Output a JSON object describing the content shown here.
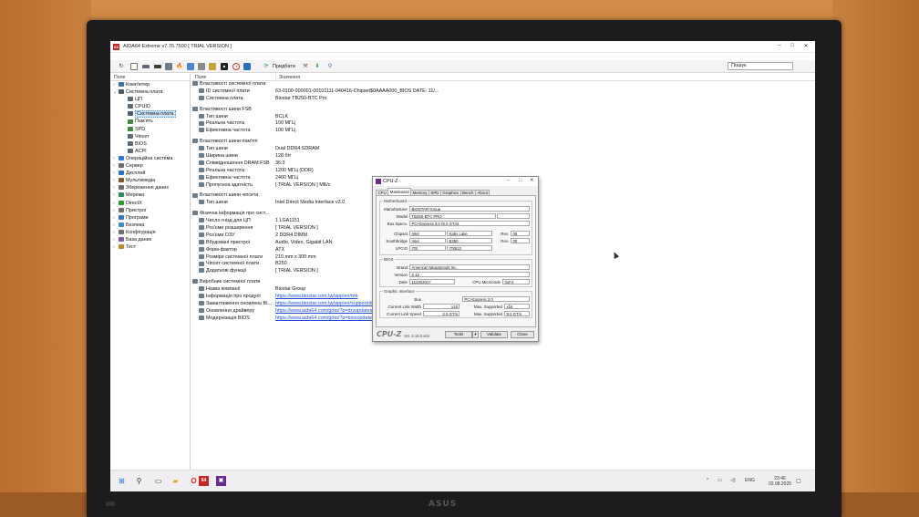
{
  "window": {
    "title": "AIDA64 Extreme v7.70.7500  [ TRIAL VERSION ]",
    "app_icon_text": "64"
  },
  "toolbar": {
    "report_label": "Придбати",
    "search_placeholder": "Пошук"
  },
  "tree": {
    "header": "Поле",
    "items": [
      {
        "label": "Комп'ютер",
        "level": 0,
        "expander": "›",
        "color": "#3b6fb6"
      },
      {
        "label": "Системна плата",
        "level": 0,
        "expander": "⌄",
        "color": "#4a5d70"
      },
      {
        "label": "ЦП",
        "level": 1,
        "expander": "",
        "color": "#5b6b7a"
      },
      {
        "label": "CPUID",
        "level": 1,
        "expander": "",
        "color": "#5b6b7a"
      },
      {
        "label": "Системна плата",
        "level": 1,
        "expander": "",
        "color": "#4a5d70",
        "selected": true
      },
      {
        "label": "Пам'ять",
        "level": 1,
        "expander": "",
        "color": "#3f8a3f"
      },
      {
        "label": "SPD",
        "level": 1,
        "expander": "",
        "color": "#3f8a3f"
      },
      {
        "label": "Чіпсет",
        "level": 1,
        "expander": "",
        "color": "#5b6b7a"
      },
      {
        "label": "BIOS",
        "level": 1,
        "expander": "",
        "color": "#5b6b7a"
      },
      {
        "label": "ACPI",
        "level": 1,
        "expander": "",
        "color": "#5b6b7a"
      },
      {
        "label": "Операційна система",
        "level": 0,
        "expander": "›",
        "color": "#2f7ad0"
      },
      {
        "label": "Сервер",
        "level": 0,
        "expander": "›",
        "color": "#6d6d6d"
      },
      {
        "label": "Дисплей",
        "level": 0,
        "expander": "›",
        "color": "#2f6fc0"
      },
      {
        "label": "Мультимедіа",
        "level": 0,
        "expander": "›",
        "color": "#7d5a2e"
      },
      {
        "label": "Збереження даних",
        "level": 0,
        "expander": "›",
        "color": "#6d6d6d"
      },
      {
        "label": "Мережа",
        "level": 0,
        "expander": "›",
        "color": "#2e8a5a"
      },
      {
        "label": "DirectX",
        "level": 0,
        "expander": "›",
        "color": "#2f9a2f"
      },
      {
        "label": "Пристрої",
        "level": 0,
        "expander": "›",
        "color": "#6d6d6d"
      },
      {
        "label": "Програми",
        "level": 0,
        "expander": "›",
        "color": "#3a6fc0"
      },
      {
        "label": "Безпека",
        "level": 0,
        "expander": "›",
        "color": "#3a8ad0"
      },
      {
        "label": "Конфігурація",
        "level": 0,
        "expander": "›",
        "color": "#6d6d6d"
      },
      {
        "label": "База даних",
        "level": 0,
        "expander": "›",
        "color": "#7a5a9a"
      },
      {
        "label": "Тест",
        "level": 0,
        "expander": "›",
        "color": "#c0882e"
      }
    ]
  },
  "list": {
    "col_field": "Поле",
    "col_value": "Значення",
    "rows": [
      {
        "type": "sec",
        "field": "Властивості системної плати",
        "value": ""
      },
      {
        "type": "sub",
        "field": "ID системної плати",
        "value": "63-0100-000001-00101111-040416-Chipset$0AAAA000_BIOS DATE: 11/..."
      },
      {
        "type": "sub",
        "field": "Системна плата",
        "value": "Biostar TB250-BTC Pro"
      },
      {
        "type": "gap"
      },
      {
        "type": "sec",
        "field": "Властивості шини FSB",
        "value": ""
      },
      {
        "type": "sub",
        "field": "Тип шини",
        "value": "BCLK"
      },
      {
        "type": "sub",
        "field": "Реальна частота",
        "value": "100 МГЦ"
      },
      {
        "type": "sub",
        "field": "Ефективна частота",
        "value": "100 МГЦ"
      },
      {
        "type": "gap"
      },
      {
        "type": "sec",
        "field": "Властивості шини пам'яті",
        "value": ""
      },
      {
        "type": "sub",
        "field": "Тип шини",
        "value": "Dual DDR4 SDRAM"
      },
      {
        "type": "sub",
        "field": "Ширина шини",
        "value": "128 біт"
      },
      {
        "type": "sub",
        "field": "Співвідношення DRAM:FSB",
        "value": "36:3"
      },
      {
        "type": "sub",
        "field": "Реальна частота",
        "value": "1200 МГЦ (DDR)"
      },
      {
        "type": "sub",
        "field": "Ефективна частота",
        "value": "2400 МГЦ"
      },
      {
        "type": "sub",
        "field": "Пропускна здатність",
        "value": "[ TRIAL VERSION ] МБ/с"
      },
      {
        "type": "gap"
      },
      {
        "type": "sec",
        "field": "Властивості шини чіпсета",
        "value": ""
      },
      {
        "type": "sub",
        "field": "Тип шини",
        "value": "Intel Direct Media Interface v3.0"
      },
      {
        "type": "gap"
      },
      {
        "type": "sec",
        "field": "Фізична інформація про сист...",
        "value": ""
      },
      {
        "type": "sub",
        "field": "Число гнізд для ЦП",
        "value": "1 LGA1151"
      },
      {
        "type": "sub",
        "field": "Роз'єми розширення",
        "value": "[ TRIAL VERSION ]"
      },
      {
        "type": "sub",
        "field": "Роз'єми ОЗУ",
        "value": "2 DDR4 DIMM"
      },
      {
        "type": "sub",
        "field": "Вбудовані пристрої",
        "value": "Audio, Video, Gigabit LAN"
      },
      {
        "type": "sub",
        "field": "Форм-фактор",
        "value": "ATX"
      },
      {
        "type": "sub",
        "field": "Розміри системної плати",
        "value": "210 mm x 300 mm"
      },
      {
        "type": "sub",
        "field": "Чіпсет системної плати",
        "value": "B250"
      },
      {
        "type": "sub",
        "field": "Додаткові функції",
        "value": "[ TRIAL VERSION ]"
      },
      {
        "type": "gap"
      },
      {
        "type": "sec",
        "field": "Виробник системної плати",
        "value": ""
      },
      {
        "type": "sub",
        "field": "Назва компанії",
        "value": "Biostar Group"
      },
      {
        "type": "sub",
        "field": "Інформація про продукт",
        "value": "https://www.biostar.com.tw/app/en/mb",
        "link": true
      },
      {
        "type": "sub",
        "field": "Завантаження оновлень BI...",
        "value": "https://www.biostar.com.tw/app/en/support/download.php",
        "link": true
      },
      {
        "type": "sub",
        "field": "Оновлення драйверу",
        "value": "https://www.aida64.com/goto/?p=drvupdates",
        "link": true
      },
      {
        "type": "sub",
        "field": "Модернізація BIOS",
        "value": "https://www.aida64.com/goto/?p=biosupdates",
        "link": true
      }
    ]
  },
  "cpuz": {
    "title": "CPU-Z",
    "tabs": [
      "CPU",
      "Mainboard",
      "Memory",
      "SPD",
      "Graphics",
      "Bench",
      "About"
    ],
    "active_tab": "Mainboard",
    "motherboard": {
      "group": "Motherboard",
      "manufacturer_label": "Manufacturer",
      "manufacturer": "BIOSTAR Group",
      "model_label": "Model",
      "model": "TB250-BTC PRO",
      "bus_label": "Bus Specs.",
      "bus": "PCI-Express 3.0 (8.0 GT/s)",
      "chipset_label": "Chipset",
      "chipset_vendor": "Intel",
      "chipset_name": "Kaby Lake",
      "chipset_rev_label": "Rev.",
      "chipset_rev": "05",
      "south_label": "Southbridge",
      "south_vendor": "Intel",
      "south_name": "B250",
      "south_rev_label": "Rev.",
      "south_rev": "00",
      "lpcio_label": "LPCIO",
      "lpcio_vendor": "ITE",
      "lpcio_name": "IT8613"
    },
    "bios": {
      "group": "BIOS",
      "brand_label": "Brand",
      "brand": "American Megatrends Inc.",
      "version_label": "Version",
      "version": "5.12",
      "date_label": "Date",
      "date": "11/29/2017",
      "microcode_label": "CPU Microcode",
      "microcode": "0xF4"
    },
    "graphic": {
      "group": "Graphic Interface",
      "bus_label": "Bus",
      "bus": "PCI-Express 3.0",
      "width_label": "Current Link Width",
      "width": "x16",
      "max_width_label": "Max. Supported",
      "max_width": "x16",
      "speed_label": "Current Link Speed",
      "speed": "2.5 GT/s",
      "max_speed_label": "Max. Supported",
      "max_speed": "8.0 GT/s"
    },
    "footer": {
      "logo": "CPU-Z",
      "version": "Ver. 2.16.0.x64",
      "tools": "Tools",
      "validate": "Validate",
      "close": "Close"
    }
  },
  "taskbar": {
    "tray_lang": "ENG",
    "time": "23:46",
    "date": "02.08.2025"
  },
  "monitor": {
    "brand": "ASUS"
  }
}
